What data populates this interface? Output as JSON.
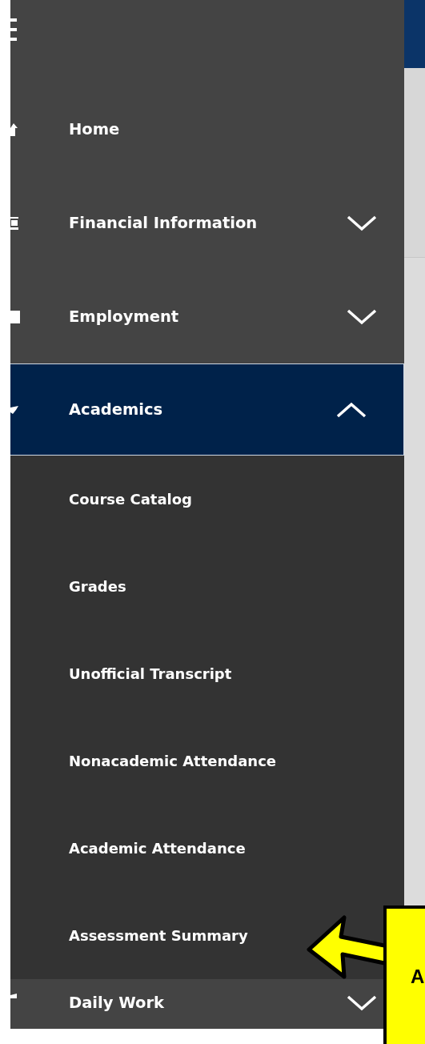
{
  "menu": {
    "items": [
      {
        "label": "Home",
        "kind": "link",
        "selected": false
      },
      {
        "label": "Financial Information",
        "kind": "group",
        "selected": false,
        "expanded": false
      },
      {
        "label": "Employment",
        "kind": "group",
        "selected": false,
        "expanded": false
      },
      {
        "label": "Academics",
        "kind": "group",
        "selected": true,
        "expanded": true,
        "children": [
          {
            "label": "Course Catalog"
          },
          {
            "label": "Grades"
          },
          {
            "label": "Unofficial Transcript"
          },
          {
            "label": "Nonacademic Attendance"
          },
          {
            "label": "Academic Attendance"
          },
          {
            "label": "Assessment Summary"
          }
        ]
      },
      {
        "label": "Daily Work",
        "kind": "group",
        "selected": false,
        "expanded": false
      }
    ]
  },
  "callout": {
    "text": "A"
  }
}
